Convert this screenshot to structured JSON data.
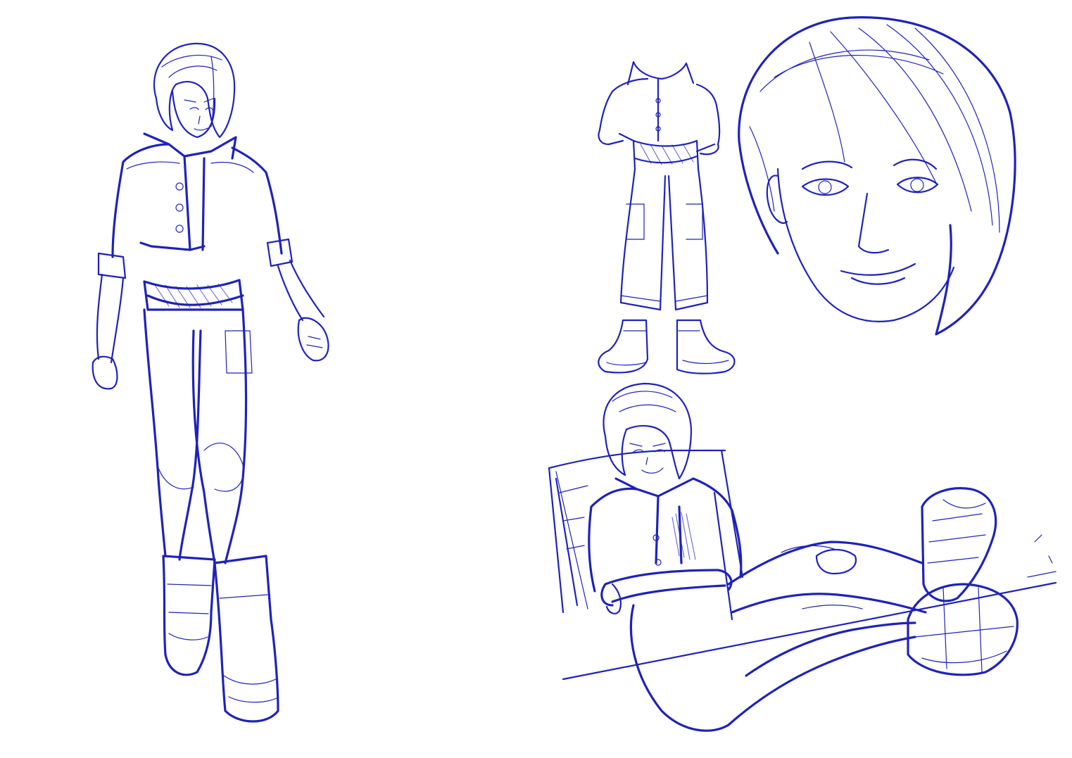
{
  "canvas": {
    "background": "#ffffff",
    "ink_color": "#1f22b8",
    "ink_color_light": "#3b3fd0"
  },
  "figures": [
    {
      "subject": "full-body-standing",
      "icon": "figure-standing-icon"
    },
    {
      "subject": "outfit-front-view-headless",
      "icon": "outfit-icon"
    },
    {
      "subject": "head-portrait-smiling",
      "icon": "portrait-icon"
    },
    {
      "subject": "seated-reclining-pose",
      "icon": "figure-seated-icon"
    }
  ]
}
